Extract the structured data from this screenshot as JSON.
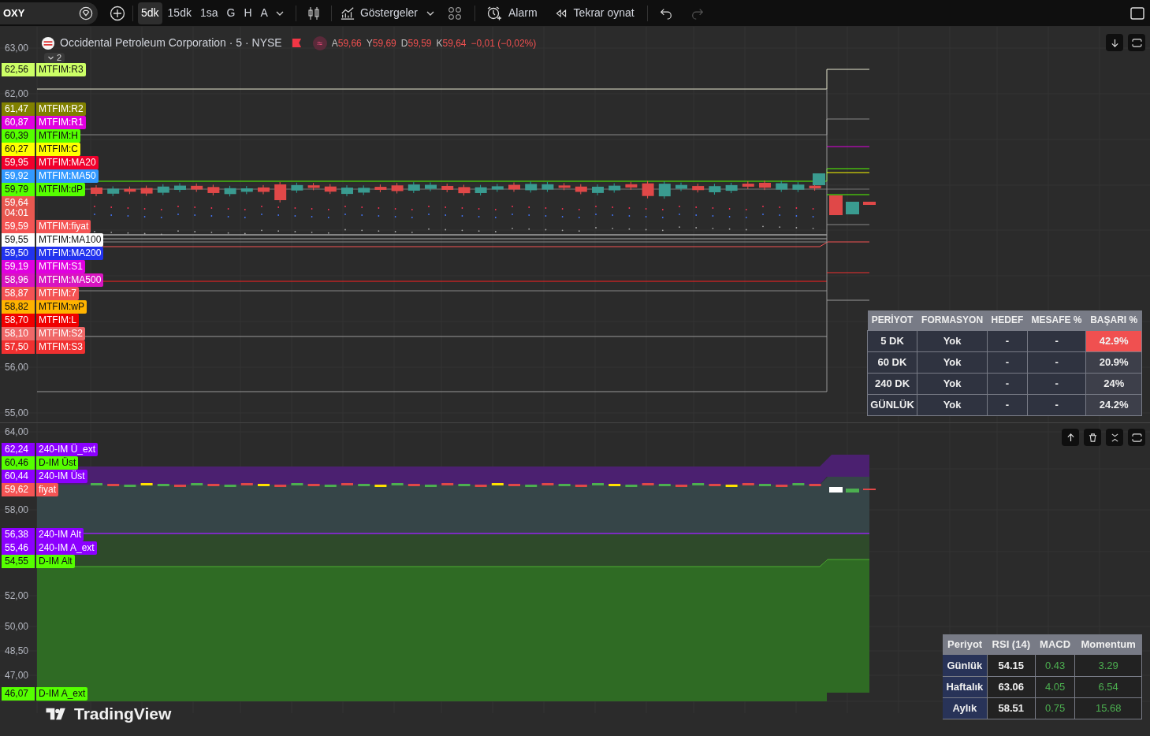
{
  "toolbar": {
    "symbol": "OXY",
    "intervals": [
      {
        "label": "5dk",
        "selected": true
      },
      {
        "label": "15dk",
        "selected": false
      },
      {
        "label": "1sa",
        "selected": false
      },
      {
        "label": "G",
        "selected": false
      },
      {
        "label": "H",
        "selected": false
      },
      {
        "label": "A",
        "selected": false
      }
    ],
    "indicators": "Göstergeler",
    "alarm": "Alarm",
    "replay": "Tekrar oynat",
    "redo_disabled": true
  },
  "legend": {
    "title": "Occidental Petroleum Corporation · 5 · NYSE",
    "ohlc": [
      {
        "label": "A",
        "value": "59,66"
      },
      {
        "label": "Y",
        "value": "59,69"
      },
      {
        "label": "D",
        "value": "59,59"
      },
      {
        "label": "K",
        "value": "59,64"
      }
    ],
    "change": "−0,01 (−0,02%)",
    "badge": "≈",
    "collapsed_count": "2"
  },
  "pane1": {
    "ticks": [
      "63,00",
      "62,00",
      "56,00",
      "55,00"
    ],
    "top_tag": {
      "value": "62,56",
      "name": "MTFIM:R3",
      "color": "#ccff66"
    },
    "tags": [
      {
        "value": "61,47",
        "name": "MTFIM:R2",
        "color": "#808000"
      },
      {
        "value": "60,87",
        "name": "MTFIM:R1",
        "color": "#e000e0"
      },
      {
        "value": "60,39",
        "name": "MTFIM:H",
        "color": "#55ff00"
      },
      {
        "value": "60,27",
        "name": "MTFIM:C",
        "color": "#ffff00"
      },
      {
        "value": "59,95",
        "name": "MTFIM:MA20",
        "color": "#f0002c"
      },
      {
        "value": "59,92",
        "name": "MTFIM:MA50",
        "color": "#3399ff"
      },
      {
        "value": "59,79",
        "name": "MTFIM:dP",
        "color": "#55ff00"
      },
      {
        "kind": "current",
        "value": "59,64",
        "countdown": "04:01",
        "color": "#e85850"
      },
      {
        "value": "59,59",
        "name": "MTFIM:fiyat",
        "color": "#f45454"
      },
      {
        "value": "59,55",
        "name": "MTFIM:MA100",
        "color": "#ffffff"
      },
      {
        "value": "59,50",
        "name": "MTFIM:MA200",
        "color": "#2233ee"
      },
      {
        "value": "59,19",
        "name": "MTFIM:S1",
        "color": "#e000e0"
      },
      {
        "value": "58,96",
        "name": "MTFIM:MA500",
        "color": "#d814c0"
      },
      {
        "value": "58,87",
        "name": "MTFIM:7",
        "color": "#f45454"
      },
      {
        "value": "58,82",
        "name": "MTFIM:wP",
        "color": "#ffb300"
      },
      {
        "value": "58,70",
        "name": "MTFIM:L",
        "color": "#f00000"
      },
      {
        "value": "58,10",
        "name": "MTFIM:S2",
        "color": "#f06868"
      },
      {
        "value": "57,50",
        "name": "MTFIM:S3",
        "color": "#f03030"
      }
    ]
  },
  "pattern_table": {
    "columns": [
      "PERİYOT",
      "FORMASYON",
      "HEDEF",
      "MESAFE %",
      "BAŞARI %"
    ],
    "rows": [
      {
        "cells": [
          "5 DK",
          "Yok",
          "-",
          "-",
          "42.9%"
        ],
        "highlighted": true
      },
      {
        "cells": [
          "60 DK",
          "Yok",
          "-",
          "-",
          "20.9%"
        ],
        "highlighted": false
      },
      {
        "cells": [
          "240 DK",
          "Yok",
          "-",
          "-",
          "24%"
        ],
        "highlighted": false
      },
      {
        "cells": [
          "GÜNLÜK",
          "Yok",
          "-",
          "-",
          "24.2%"
        ],
        "highlighted": false
      }
    ]
  },
  "pane2": {
    "ticks": [
      "64,00",
      "58,00",
      "52,00",
      "50,00",
      "48,50",
      "47,00"
    ],
    "tags": [
      {
        "value": "62,24",
        "name": "240-IM Ü_ext",
        "color": "#8c00ff"
      },
      {
        "value": "60,46",
        "name": "D-IM Üst",
        "color": "#55ff00"
      },
      {
        "value": "60,44",
        "name": "240-IM Üst",
        "color": "#8c00ff"
      },
      {
        "value": "59,62",
        "name": "fiyat",
        "color": "#f45454"
      },
      {
        "value": "56,38",
        "name": "240-IM Alt",
        "color": "#8c00ff"
      },
      {
        "value": "55,46",
        "name": "240-IM A_ext",
        "color": "#8c00ff"
      },
      {
        "value": "54,55",
        "name": "D-IM Alt",
        "color": "#55ff00"
      },
      {
        "value": "46,07",
        "name": "D-IM A_ext",
        "color": "#55ff00"
      }
    ]
  },
  "momentum_table": {
    "columns": [
      "Periyot",
      "RSI (14)",
      "MACD",
      "Momentum"
    ],
    "rows": [
      {
        "cells": [
          "Günlük",
          "54.15",
          "0.43",
          "3.29"
        ]
      },
      {
        "cells": [
          "Haftalık",
          "63.06",
          "4.05",
          "6.54"
        ]
      },
      {
        "cells": [
          "Aylık",
          "58.51",
          "0.75",
          "15.68"
        ]
      }
    ]
  },
  "watermark": "TradingView"
}
